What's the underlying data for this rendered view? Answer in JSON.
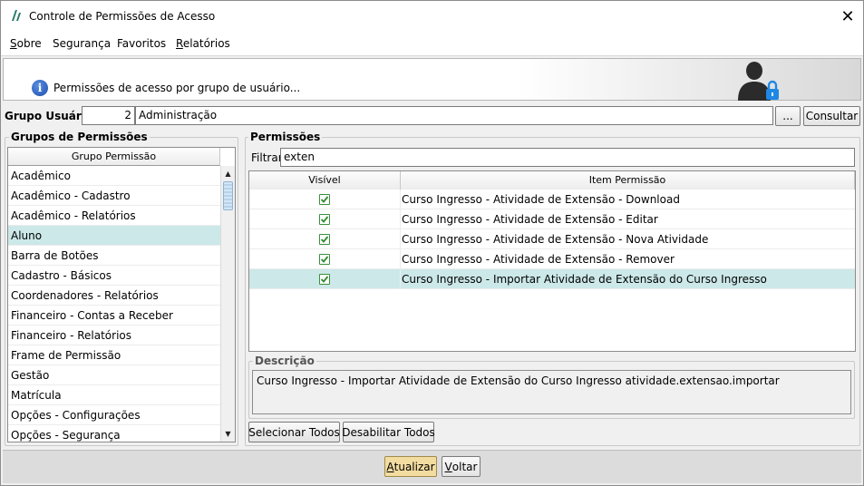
{
  "window": {
    "title": "Controle de Permissões de Acesso",
    "close_glyph": "✕"
  },
  "menu": [
    {
      "pre": "",
      "u": "S",
      "post": "obre"
    },
    {
      "pre": "Segurança",
      "u": "",
      "post": ""
    },
    {
      "pre": "Favoritos",
      "u": "",
      "post": ""
    },
    {
      "pre": "",
      "u": "R",
      "post": "elatórios"
    }
  ],
  "banner": {
    "text": "Permissões de acesso por grupo de usuário...",
    "info_glyph": "i",
    "icon": "user-lock-icon"
  },
  "grupo_usuario": {
    "label": "Grupo Usuário:",
    "code": "2",
    "name": "Administração",
    "lookup_label": "...",
    "consultar_label": "Consultar"
  },
  "grupos": {
    "title": "Grupos de Permissões",
    "column": "Grupo Permissão",
    "items": [
      "Acadêmico",
      "Acadêmico - Cadastro",
      "Acadêmico - Relatórios",
      "Aluno",
      "Barra de Botões",
      "Cadastro - Básicos",
      "Coordenadores - Relatórios",
      "Financeiro - Contas a Receber",
      "Financeiro - Relatórios",
      "Frame de Permissão",
      "Gestão",
      "Matrícula",
      "Opções - Configurações",
      "Opções - Segurança"
    ],
    "selected_index": 3
  },
  "permissoes": {
    "title": "Permissões",
    "filter_label": "Filtrar:",
    "filter_value": "exten",
    "columns": [
      "Visível",
      "Item Permissão"
    ],
    "rows": [
      {
        "visible": true,
        "item": "Curso Ingresso - Atividade de Extensão - Download"
      },
      {
        "visible": true,
        "item": "Curso Ingresso - Atividade de Extensão - Editar"
      },
      {
        "visible": true,
        "item": "Curso Ingresso - Atividade de Extensão - Nova Atividade"
      },
      {
        "visible": true,
        "item": "Curso Ingresso - Atividade de Extensão - Remover"
      },
      {
        "visible": true,
        "item": "Curso Ingresso - Importar Atividade de Extensão do Curso Ingresso"
      }
    ],
    "selected_index": 4,
    "descricao_title": "Descrição",
    "descricao_text": "Curso Ingresso - Importar Atividade de Extensão do Curso Ingresso  atividade.extensao.importar",
    "selecionar_todos": "Selecionar Todos",
    "desabilitar_todos": "Desabilitar Todos"
  },
  "footer": {
    "atualizar": {
      "u": "A",
      "rest": "tualizar"
    },
    "voltar": {
      "u": "V",
      "rest": "oltar"
    }
  },
  "colors": {
    "selection": "#cce8e8",
    "check_green": "#2e8b2e",
    "atualizar_bg": "#f3dca0"
  }
}
